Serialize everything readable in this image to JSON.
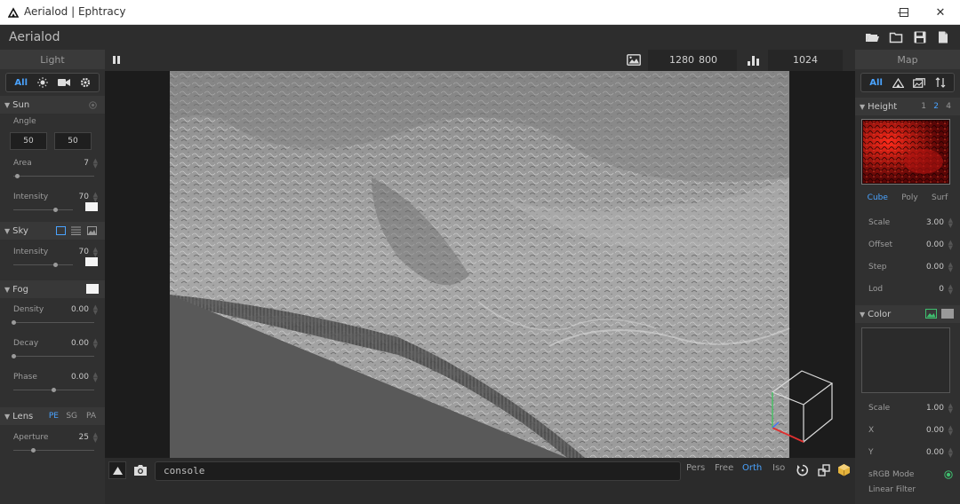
{
  "window": {
    "title": "Aerialod | Ephtracy",
    "minimize_icon": "minimize-icon",
    "maximize_icon": "maximize-icon",
    "close_icon": "close-icon"
  },
  "toolbar": {
    "app_name": "Aerialod",
    "icons": [
      "open-folder-icon",
      "folder-icon",
      "save-icon",
      "file-icon"
    ]
  },
  "left_panel": {
    "title": "Light",
    "filter": {
      "all": "All",
      "icons": [
        "sun-icon",
        "camera-icon",
        "gear-icon"
      ]
    },
    "sun": {
      "label": "Sun",
      "angle_label": "Angle",
      "angle_a": "50",
      "angle_b": "50",
      "area_label": "Area",
      "area_value": "7",
      "area_fraction": 0.05,
      "intensity_label": "Intensity",
      "intensity_value": "70",
      "intensity_fraction": 0.7
    },
    "sky": {
      "label": "Sky",
      "intensity_label": "Intensity",
      "intensity_value": "70",
      "intensity_fraction": 0.7
    },
    "fog": {
      "label": "Fog",
      "density_label": "Density",
      "density_value": "0.00",
      "decay_label": "Decay",
      "decay_value": "0.00",
      "phase_label": "Phase",
      "phase_value": "0.00",
      "phase_fraction": 0.5
    },
    "lens": {
      "label": "Lens",
      "tabs": [
        "PE",
        "SG",
        "PA"
      ],
      "aperture_label": "Aperture",
      "aperture_value": "25",
      "aperture_fraction": 0.25
    }
  },
  "viewport": {
    "width": "1280",
    "height": "800",
    "samples": "1024",
    "console": "console",
    "modes": [
      "Pers",
      "Free",
      "Orth",
      "Iso"
    ],
    "active_mode": "Orth"
  },
  "right_panel": {
    "title": "Map",
    "filter": {
      "all": "All",
      "icons": [
        "terrain-icon",
        "image-icon",
        "sort-icon"
      ]
    },
    "height": {
      "label": "Height",
      "levels": [
        "1",
        "2",
        "4"
      ],
      "active_level": "2",
      "tabs": [
        "Cube",
        "Poly",
        "Surf"
      ],
      "active_tab": "Cube",
      "scale_label": "Scale",
      "scale_value": "3.00",
      "offset_label": "Offset",
      "offset_value": "0.00",
      "step_label": "Step",
      "step_value": "0.00",
      "lod_label": "Lod",
      "lod_value": "0"
    },
    "color": {
      "label": "Color",
      "scale_label": "Scale",
      "scale_value": "1.00",
      "x_label": "X",
      "x_value": "0.00",
      "y_label": "Y",
      "y_value": "0.00",
      "srgb_label": "sRGB Mode",
      "linear_label": "Linear Filter"
    }
  },
  "colors": {
    "accent": "#4aa3ff",
    "panel": "#303030",
    "background": "#2b2b2b",
    "toggle_on": "#3fbf6f"
  }
}
